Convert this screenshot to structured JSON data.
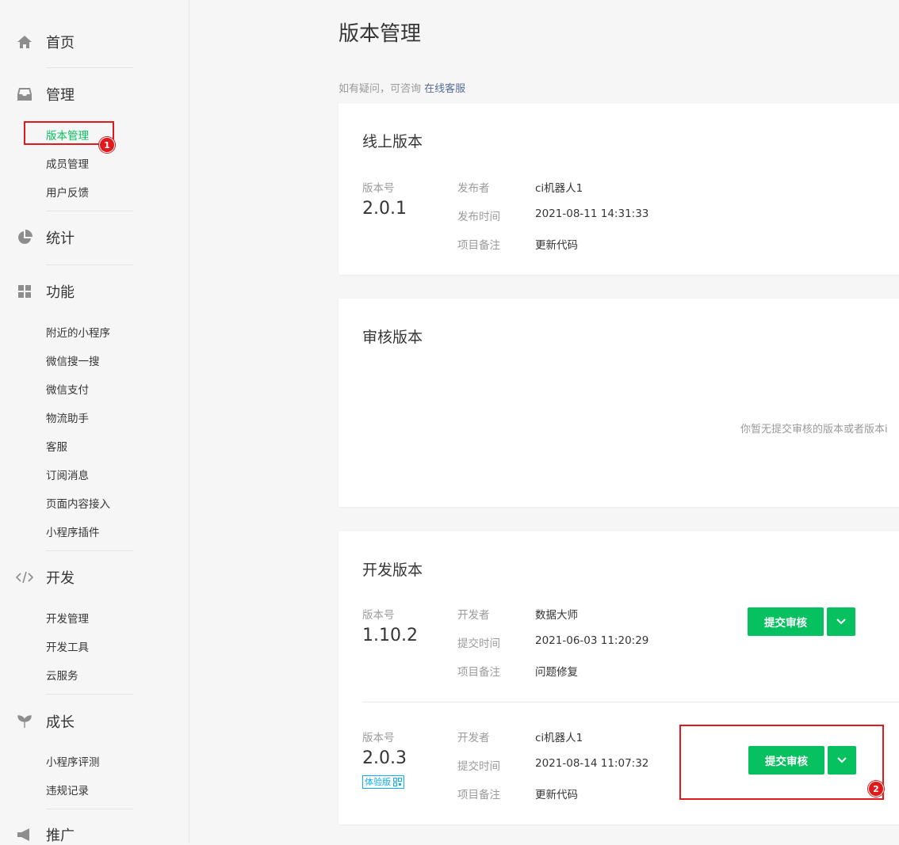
{
  "sidebar": {
    "home": "首页",
    "manage": "管理",
    "manage_items": [
      "版本管理",
      "成员管理",
      "用户反馈"
    ],
    "stats": "统计",
    "features": "功能",
    "feature_items": [
      "附近的小程序",
      "微信搜一搜",
      "微信支付",
      "物流助手",
      "客服",
      "订阅消息",
      "页面内容接入",
      "小程序插件"
    ],
    "dev": "开发",
    "dev_items": [
      "开发管理",
      "开发工具",
      "云服务"
    ],
    "growth": "成长",
    "growth_items": [
      "小程序评测",
      "违规记录"
    ],
    "promote": "推广"
  },
  "annotations": {
    "badge1": "1",
    "badge2": "2"
  },
  "page": {
    "title": "版本管理",
    "help_text": "如有疑问，可咨询",
    "help_link": "在线客服"
  },
  "online": {
    "title": "线上版本",
    "ver_label": "版本号",
    "version": "2.0.1",
    "publisher_label": "发布者",
    "publisher": "ci机器人1",
    "time_label": "发布时间",
    "time": "2021-08-11 14:31:33",
    "note_label": "项目备注",
    "note": "更新代码"
  },
  "review": {
    "title": "审核版本",
    "empty": "你暂无提交审核的版本或者版本i"
  },
  "dev": {
    "title": "开发版本",
    "rows": [
      {
        "ver_label": "版本号",
        "version": "1.10.2",
        "dev_label": "开发者",
        "developer": "数据大师",
        "time_label": "提交时间",
        "time": "2021-06-03 11:20:29",
        "note_label": "项目备注",
        "note": "问题修复",
        "submit": "提交审核"
      },
      {
        "ver_label": "版本号",
        "version": "2.0.3",
        "tag": "体验版",
        "dev_label": "开发者",
        "developer": "ci机器人1",
        "time_label": "提交时间",
        "time": "2021-08-14 11:07:32",
        "note_label": "项目备注",
        "note": "更新代码",
        "submit": "提交审核"
      }
    ]
  },
  "colors": {
    "accent": "#07c160",
    "annotation": "#e0191c",
    "tag": "#10aeff",
    "link": "#576b95"
  }
}
